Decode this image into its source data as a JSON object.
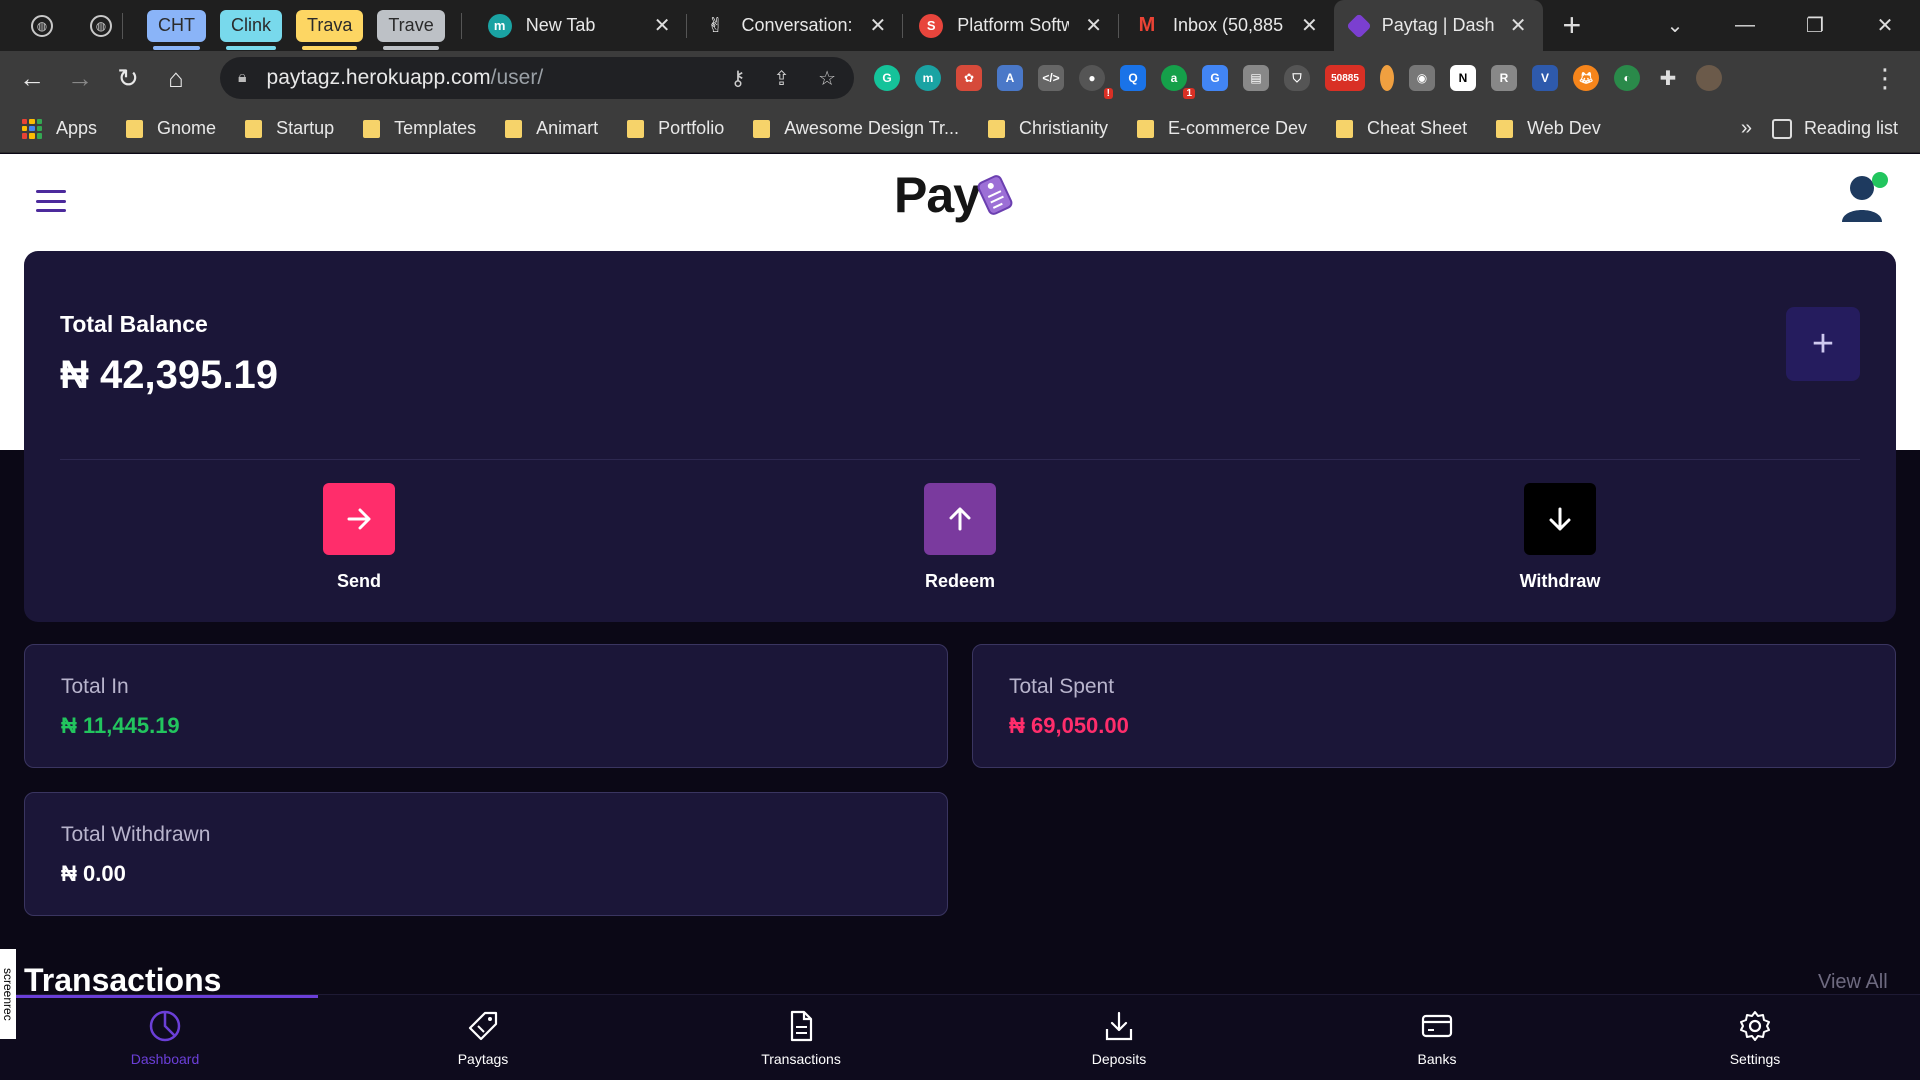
{
  "browser": {
    "tab_groups": [
      {
        "label": "CHT",
        "color": "#8ab4f8"
      },
      {
        "label": "Clink",
        "color": "#78d9ec"
      },
      {
        "label": "Trava",
        "color": "#fdd663"
      },
      {
        "label": "Trave",
        "color": "#bdc1c6"
      }
    ],
    "tabs": [
      {
        "title": "New Tab",
        "icon": "m-circle-icon",
        "color": "#1aa3a3"
      },
      {
        "title": "Conversation:",
        "icon": "peace-hand-icon",
        "color": "#3c3c3c"
      },
      {
        "title": "Platform Softw",
        "icon": "s-logo-icon",
        "color": "#e8453c"
      },
      {
        "title": "Inbox (50,885",
        "icon": "gmail-icon",
        "color": "#ea4335"
      },
      {
        "title": "Paytag | Dash",
        "icon": "paytag-tag-icon",
        "color": "#7b3fd0"
      }
    ],
    "url_main": "paytagz.herokuapp.com",
    "url_path": "/user/",
    "ext_badges": {
      "mail_count": "50885",
      "notif_1": "1",
      "notif_2": "!"
    },
    "bookmarks": [
      "Apps",
      "Gnome",
      "Startup",
      "Templates",
      "Animart",
      "Portfolio",
      "Awesome Design Tr...",
      "Christianity",
      "E-commerce Dev",
      "Cheat Sheet",
      "Web Dev"
    ],
    "more": "»",
    "reading_list": "Reading list"
  },
  "app": {
    "logo_text": "Pay",
    "balance": {
      "label": "Total Balance",
      "amount": "₦ 42,395.19"
    },
    "actions": [
      {
        "label": "Send",
        "color": "#ff2d6b"
      },
      {
        "label": "Redeem",
        "color": "#7a3a9e"
      },
      {
        "label": "Withdraw",
        "color": "#000000"
      }
    ],
    "stats": [
      {
        "label": "Total In",
        "value": "₦ 11,445.19",
        "color": "#22c55e"
      },
      {
        "label": "Total Spent",
        "value": "₦ 69,050.00",
        "color": "#ff2d6b"
      },
      {
        "label": "Total Withdrawn",
        "value": "₦ 0.00",
        "color": "#ffffff"
      }
    ],
    "transactions_title": "Transactions",
    "view_all": "View All",
    "nav": [
      {
        "label": "Dashboard",
        "icon": "pie-chart-icon",
        "active": true
      },
      {
        "label": "Paytags",
        "icon": "tag-icon",
        "active": false
      },
      {
        "label": "Transactions",
        "icon": "document-icon",
        "active": false
      },
      {
        "label": "Deposits",
        "icon": "download-icon",
        "active": false
      },
      {
        "label": "Banks",
        "icon": "card-icon",
        "active": false
      },
      {
        "label": "Settings",
        "icon": "gear-icon",
        "active": false
      }
    ],
    "accent": "#6b3fd8"
  },
  "overlay": {
    "screenrec": "screenrec"
  }
}
